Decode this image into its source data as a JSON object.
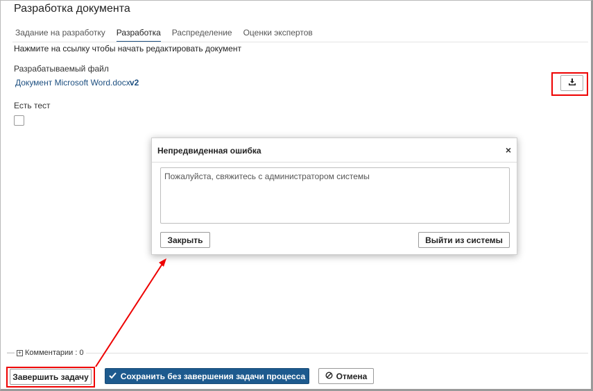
{
  "page": {
    "title": "Разработка документа"
  },
  "tabs": [
    {
      "label": "Задание на разработку",
      "active": false
    },
    {
      "label": "Разработка",
      "active": true
    },
    {
      "label": "Распределение",
      "active": false
    },
    {
      "label": "Оценки экспертов",
      "active": false
    }
  ],
  "hint": "Нажмите на ссылку чтобы начать редактировать документ",
  "file": {
    "label": "Разрабатываемый файл",
    "name": "Документ Microsoft Word.docx",
    "version": "v2",
    "download_icon": "download-icon"
  },
  "test": {
    "label": "Есть тест",
    "checked": false
  },
  "modal": {
    "title": "Непредвиденная ошибка",
    "close_glyph": "×",
    "message": "Пожалуйста, свяжитесь с администратором системы",
    "close_button": "Закрыть",
    "logout_button": "Выйти из системы"
  },
  "comments": {
    "label": "Комментарии : 0"
  },
  "footer": {
    "finish_button": "Завершить задачу",
    "save_button": "Сохранить без завершения задачи процесса",
    "cancel_button": "Отмена"
  },
  "colors": {
    "primary": "#1d5a8e",
    "link": "#1d4f80",
    "highlight": "#e00000"
  }
}
